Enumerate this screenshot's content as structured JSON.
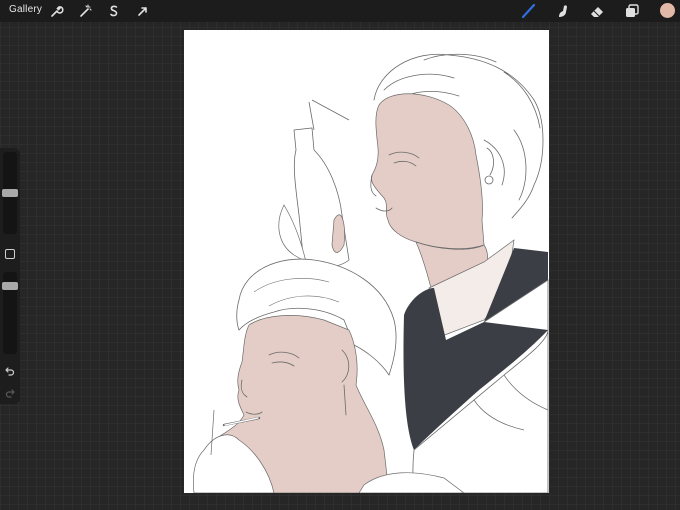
{
  "topbar": {
    "gallery_label": "Gallery",
    "actions_icons": [
      "wrench-icon",
      "magic-wand-icon",
      "selection-icon",
      "transform-icon"
    ],
    "tools_icons": [
      "brush-icon",
      "smudge-icon",
      "eraser-icon",
      "layers-icon"
    ],
    "active_tool": "brush-icon",
    "active_tool_color": "#2f6fe0",
    "current_color": "#e2b9a6"
  },
  "sidebar": {
    "brush_size_level": 0.5,
    "opacity_level": 0.17,
    "icons": [
      "modify-square-icon",
      "undo-icon",
      "redo-icon"
    ]
  },
  "canvas": {
    "background": "#ffffff",
    "ink": "#6a6a6a",
    "skin_tone": "#e4cdc6",
    "vest_color": "#3b3e45"
  }
}
